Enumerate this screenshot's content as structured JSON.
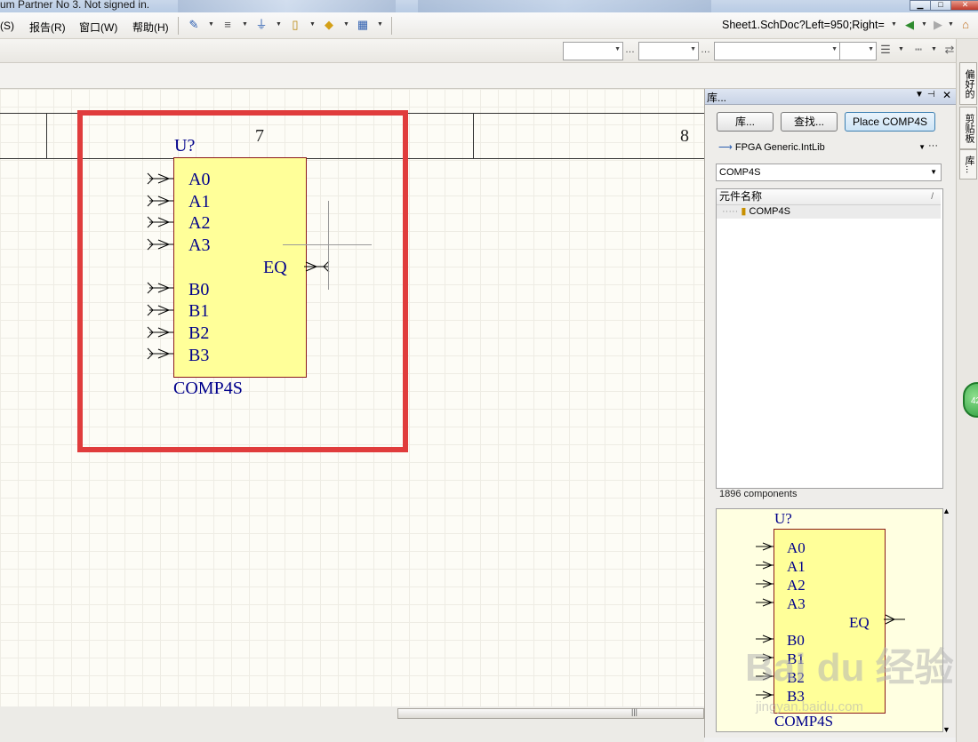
{
  "titlebar": {
    "title": "um Partner No 3. Not signed in."
  },
  "menubar": {
    "items": [
      {
        "label": "(S)"
      },
      {
        "label": "报告(R)"
      },
      {
        "label": "窗口(W)"
      },
      {
        "label": "帮助(H)"
      }
    ],
    "address": "Sheet1.SchDoc?Left=950;Right="
  },
  "sheet": {
    "zones": [
      "7",
      "8"
    ],
    "component": {
      "designator": "U?",
      "name": "COMP4S",
      "pins_left": [
        "A0",
        "A1",
        "A2",
        "A3",
        "B0",
        "B1",
        "B2",
        "B3"
      ],
      "pin_right": "EQ"
    }
  },
  "panel": {
    "title": "库...",
    "buttons": {
      "libraries": "库...",
      "search": "查找...",
      "place": "Place COMP4S"
    },
    "library": "FPGA Generic.IntLib",
    "filter": "COMP4S",
    "list_header": "元件名称",
    "list_item": "COMP4S",
    "count": "1896 components"
  },
  "sidetabs": [
    "偏好的",
    "剪贴板",
    "库..."
  ],
  "badge": "42",
  "watermark": {
    "brand": "Bai du 经验",
    "url": "jingyan.baidu.com"
  },
  "colors": {
    "highlight": "#e03c3c",
    "component_fill": "#ffff99",
    "pin_text": "#00008b"
  }
}
